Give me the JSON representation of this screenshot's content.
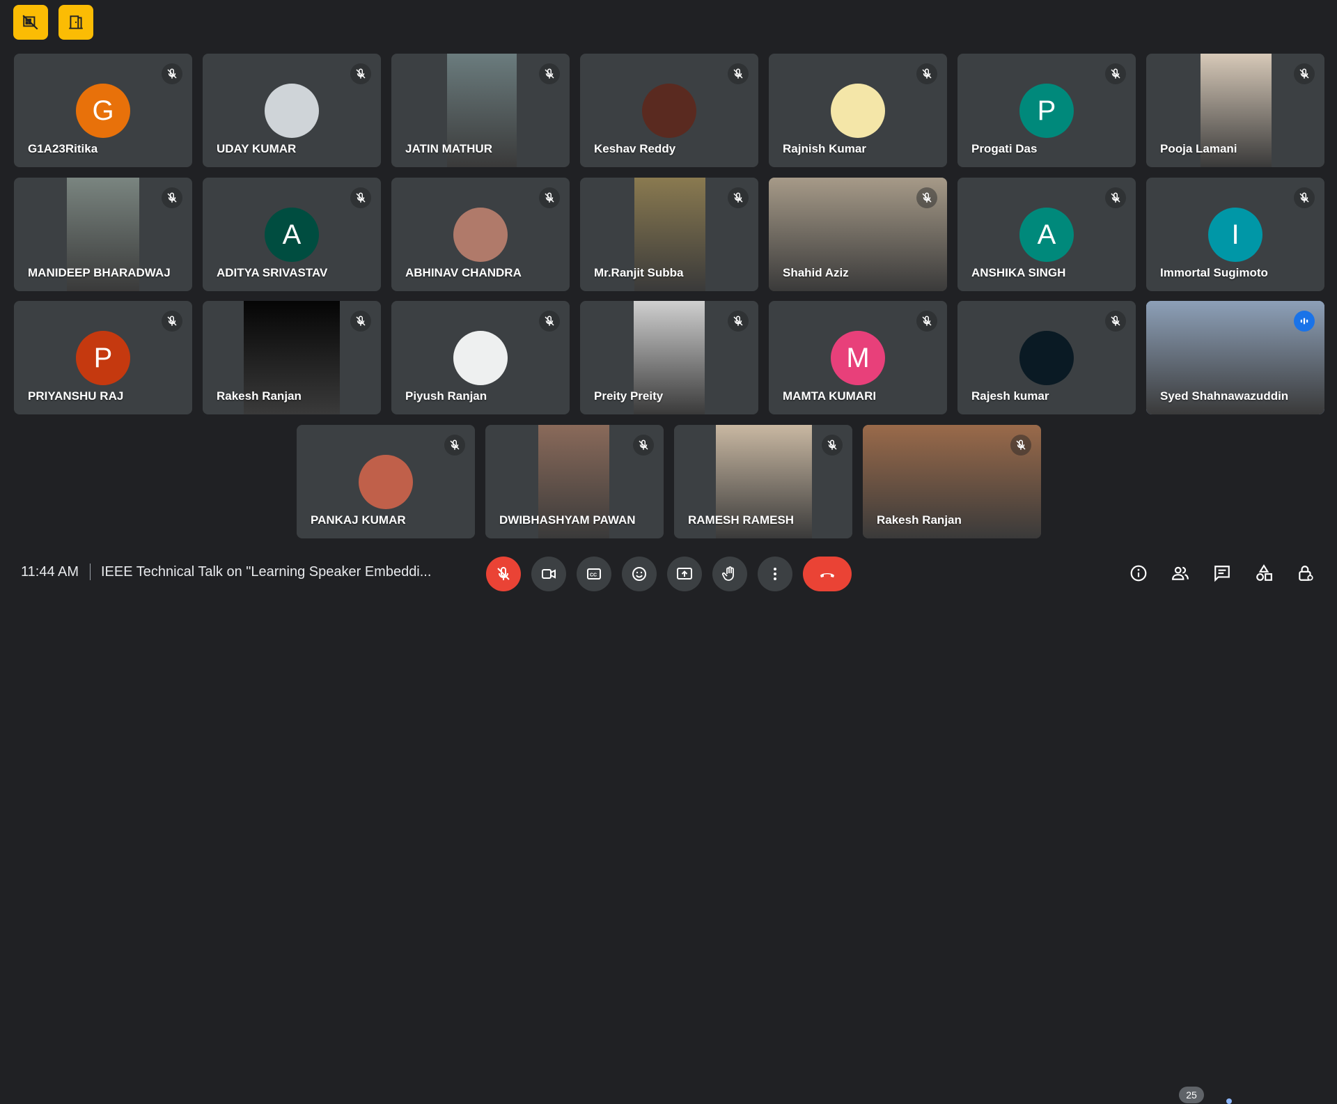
{
  "meeting": {
    "time": "11:44 AM",
    "title": "IEEE Technical Talk on \"Learning Speaker Embeddi...",
    "participant_count": "25"
  },
  "top_buttons": [
    "hide-layout-icon",
    "door-icon"
  ],
  "participants": [
    {
      "name": "G1A23Ritika",
      "initial": "G",
      "color": "#e8710a"
    },
    {
      "name": "UDAY KUMAR",
      "initial": "",
      "color": "#cfd4d8"
    },
    {
      "name": "JATIN MATHUR",
      "initial": "",
      "color": "#6b7c7e"
    },
    {
      "name": "Keshav Reddy",
      "initial": "",
      "color": "#5a2a20"
    },
    {
      "name": "Rajnish Kumar",
      "initial": "",
      "color": "#f4e6a8"
    },
    {
      "name": "Progati Das",
      "initial": "P",
      "color": "#00897b"
    },
    {
      "name": "Pooja Lamani",
      "initial": "",
      "color": "#d7c9b8"
    },
    {
      "name": "MANIDEEP BHARADWAJ",
      "initial": "",
      "color": "#7a8580"
    },
    {
      "name": "ADITYA SRIVASTAV",
      "initial": "A",
      "color": "#004d40"
    },
    {
      "name": "ABHINAV CHANDRA",
      "initial": "",
      "color": "#b07a6a"
    },
    {
      "name": "Mr.Ranjit Subba",
      "initial": "",
      "color": "#8a7a50"
    },
    {
      "name": "Shahid Aziz",
      "initial": "",
      "color": "#a69a88"
    },
    {
      "name": "ANSHIKA SINGH",
      "initial": "A",
      "color": "#00897b"
    },
    {
      "name": "Immortal Sugimoto",
      "initial": "I",
      "color": "#0097a7"
    },
    {
      "name": "PRIYANSHU RAJ",
      "initial": "P",
      "color": "#c5390f"
    },
    {
      "name": "Rakesh Ranjan",
      "initial": "",
      "color": "#050505"
    },
    {
      "name": "Piyush Ranjan",
      "initial": "",
      "color": "#eef0f0"
    },
    {
      "name": "Preity Preity",
      "initial": "",
      "color": "#cfcfcf"
    },
    {
      "name": "MAMTA KUMARI",
      "initial": "M",
      "color": "#e8407a"
    },
    {
      "name": "Rajesh kumar",
      "initial": "",
      "color": "#0a1a24"
    },
    {
      "name": "Syed Shahnawazuddin",
      "initial": "",
      "color": "#8da0b8"
    },
    {
      "name": "PANKAJ KUMAR",
      "initial": "",
      "color": "#c0604a"
    },
    {
      "name": "DWIBHASHYAM PAWAN",
      "initial": "",
      "color": "#8a6a5a"
    },
    {
      "name": "RAMESH RAMESH",
      "initial": "",
      "color": "#c9b8a2"
    },
    {
      "name": "Rakesh Ranjan",
      "initial": "",
      "color": "#9a6a4a"
    }
  ],
  "controls": [
    "mic-off-icon",
    "camera-icon",
    "captions-icon",
    "emoji-icon",
    "present-icon",
    "raise-hand-icon",
    "more-options-icon",
    "end-call-icon"
  ],
  "right_controls": [
    "info-icon",
    "people-icon",
    "chat-icon",
    "activities-icon",
    "host-controls-icon"
  ]
}
